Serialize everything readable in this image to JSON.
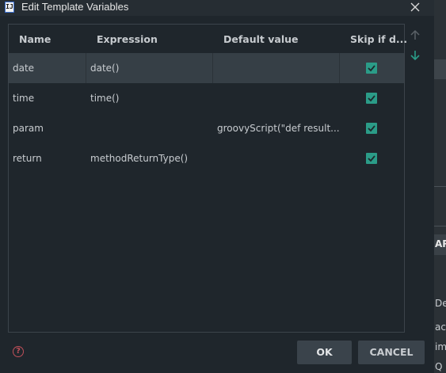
{
  "window": {
    "title": "Edit Template Variables",
    "app_logo_text": "IJ",
    "close_glyph": "✕"
  },
  "table": {
    "columns": [
      "Name",
      "Expression",
      "Default value",
      "Skip if d..."
    ],
    "rows": [
      {
        "name": "date",
        "expression": "date()",
        "default_value": "",
        "skip": true,
        "selected": true
      },
      {
        "name": "time",
        "expression": "time()",
        "default_value": "",
        "skip": true,
        "selected": false
      },
      {
        "name": "param",
        "expression": "",
        "default_value": "groovyScript(\"def result...",
        "skip": true,
        "selected": false
      },
      {
        "name": "return",
        "expression": "methodReturnType()",
        "default_value": "",
        "skip": true,
        "selected": false
      }
    ]
  },
  "side_arrows": {
    "up": "arrow-up-icon",
    "down": "arrow-down-icon"
  },
  "footer": {
    "help_glyph": "?",
    "ok_label": "OK",
    "cancel_label": "CANCEL"
  },
  "background_app": {
    "fragments": [
      "AR",
      "De",
      "ac",
      "im",
      "Q"
    ]
  },
  "colors": {
    "dialog_bg": "#1f262c",
    "selected_row": "#363f46",
    "checkbox": "#2b9c88",
    "help_icon": "#c0505a",
    "button_bg": "#3a434b"
  }
}
